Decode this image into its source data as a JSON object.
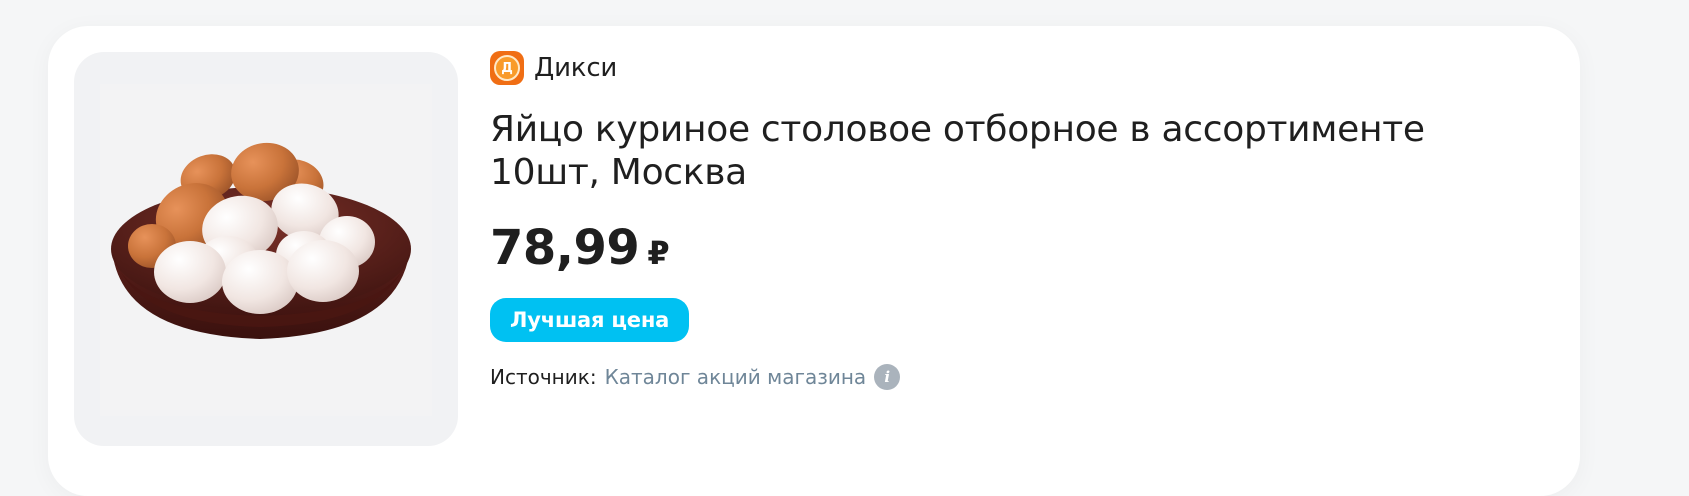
{
  "store": {
    "logo_letter": "Д",
    "name": "Дикси"
  },
  "product": {
    "title": "Яйцо куриное столовое отборное в ассортименте 10шт, Москва",
    "image_icon": "eggs-in-bowl-image"
  },
  "price": {
    "value": "78,99",
    "currency": "₽"
  },
  "badge": {
    "label": "Лучшая цена",
    "color": "#00c1f2"
  },
  "source": {
    "label": "Источник:",
    "link_text": "Каталог акций магазина",
    "info_icon_glyph": "i"
  },
  "colors": {
    "logo_orange": "#f06e14",
    "link": "#6f8698"
  }
}
